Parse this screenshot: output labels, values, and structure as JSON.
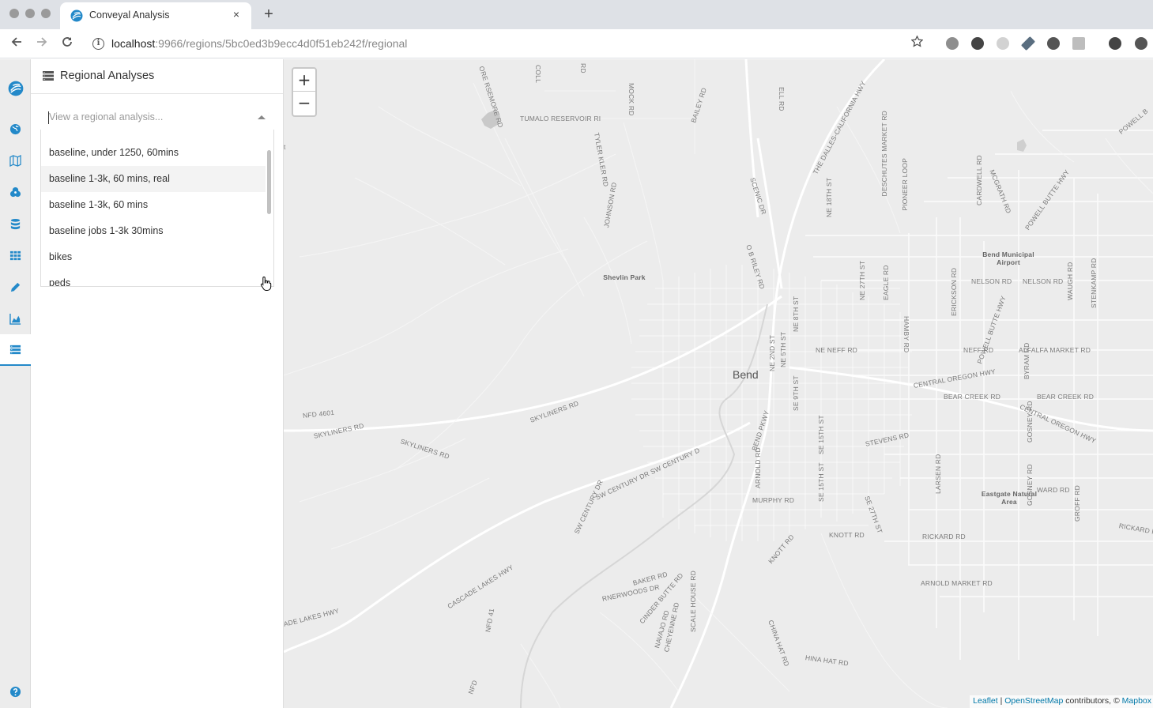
{
  "browser": {
    "tab_title": "Conveyal Analysis",
    "close_glyph": "×",
    "newtab_glyph": "+",
    "url_host": "localhost",
    "url_rest": ":9966/regions/5bc0ed3b9ecc4d0f51eb242f/regional",
    "info_glyph": "i"
  },
  "nav": {
    "items": [
      {
        "name": "logo-icon"
      },
      {
        "name": "globe-icon"
      },
      {
        "name": "map-icon"
      },
      {
        "name": "modifications-icon"
      },
      {
        "name": "database-icon"
      },
      {
        "name": "grid-icon"
      },
      {
        "name": "pencil-icon"
      },
      {
        "name": "area-chart-icon"
      },
      {
        "name": "server-icon"
      },
      {
        "name": "help-icon"
      }
    ],
    "active": "server-icon",
    "accent": "#2389c9"
  },
  "panel": {
    "title": "Regional Analyses",
    "select_placeholder": "View a regional analysis...",
    "options": [
      "baseline, under 1250, 60mins",
      "baseline 1-3k, 60 mins, real",
      "baseline 1-3k, 60 mins",
      "baseline jobs 1-3k 30mins",
      "bikes",
      "peds"
    ],
    "focused_option": "baseline 1-3k, 60 mins, real"
  },
  "map": {
    "zoom_in": "+",
    "zoom_out": "−",
    "city_label": "Bend",
    "poi": {
      "shevlin": "Shevlin Park",
      "airport": "Bend Municipal Airport",
      "eastgate": "Eastgate Natural Area"
    },
    "road_labels": {
      "tumalo_reservoir": "TUMALO RESERVOIR RI",
      "tylerkler": "TYLER KLER RD",
      "mock": "MOCK RD",
      "bailey": "BAILEY RD",
      "dalles": "THE DALLES-CALIFORNIA HWY",
      "deschutes": "DESCHUTES MARKET RD",
      "pioneer": "PIONEER LOOP",
      "mcgrath": "MCGRATH RD",
      "powell_butte_hwy": "POWELL BUTTE HWY",
      "powell_b": "POWELL B",
      "scenic": "SCENIC DR",
      "ob_riley": "O B RILEY RD",
      "johnson": "JOHNSON RD",
      "ne18": "NE 18TH ST",
      "cardwell": "CARDWELL RD",
      "nelson": "NELSON RD",
      "nelson2": "NELSON RD",
      "ne27": "NE 27TH ST",
      "eagle": "EAGLE RD",
      "hamby": "HAMBY RD",
      "erickson": "ERICKSON RD",
      "powell_butte_hwy2": "POWELL BUTTE HWY",
      "waugh": "WAUGH RD",
      "stenkamp": "STENKAMP RD",
      "ne_neff": "NE NEFF RD",
      "neff": "NEFF RD",
      "alfalfa": "ALFALFA MARKET RD",
      "ne8": "NE 8TH ST",
      "ne2": "NE 2ND ST",
      "ne5": "NE 5TH ST",
      "central_oregon": "CENTRAL OREGON HWY",
      "central_oregon2": "CENTRAL OREGON HWY",
      "byram": "BYRAM RD",
      "bear_creek": "BEAR CREEK RD",
      "bear_creek2": "BEAR CREEK RD",
      "nfd4601": "NFD 4601",
      "skyliners_w": "SKYLINERS RD",
      "skyliners_m": "SKYLINERS RD",
      "skyliners_e": "SKYLINERS RD",
      "se9": "SE 9TH ST",
      "bend_pkwy": "BEND PKWY",
      "arnold": "ARNOLD RD",
      "se15": "SE 15TH ST",
      "stevens": "STEVENS RD",
      "gosney": "GOSNEY RD",
      "sw_century": "SW CENTURY DR SW CENTURY D",
      "sw_century2": "SW CENTURY DR",
      "murphy": "MURPHY RD",
      "se15b": "SE 15TH ST",
      "se27": "SE 27TH ST",
      "larsen": "LARSEN RD",
      "ward": "WARD RD",
      "gosney2": "GOSNEY RD",
      "groff": "GROFF RD",
      "rickard": "RICKARD RD",
      "rickard2": "RICKARD R",
      "knott": "KNOTT RD",
      "knott2": "KNOTT RD",
      "cascade_lakes": "CASCADE LAKES HWY",
      "baker": "BAKER RD",
      "rnerwoods": "RNERWOODS DR",
      "cinder_butte": "CINDER BUTTE RD",
      "arnold_market": "ARNOLD MARKET RD",
      "ade_lakes": "ADE LAKES HWY",
      "nfd41": "NFD 41",
      "navajo": "NAVAJO RD",
      "cheyenne": "CHEYENNE RD",
      "scale_house": "SCALE HOUSE RD",
      "china_hat": "CHINA HAT RD",
      "hina_hat": "HINA HAT RD",
      "nfd_bottom": "NFD",
      "ore_rsemore": "ORE RSEMORE RD",
      "coll": "COLL",
      "ell": "ELL RD",
      "rd_top": "RD",
      "t_edge": "t"
    },
    "attribution": {
      "leaflet": "Leaflet",
      "sep": " | ",
      "osm": "OpenStreetMap",
      "rest": " contributors, © ",
      "mapbox": "Mapbox"
    }
  }
}
